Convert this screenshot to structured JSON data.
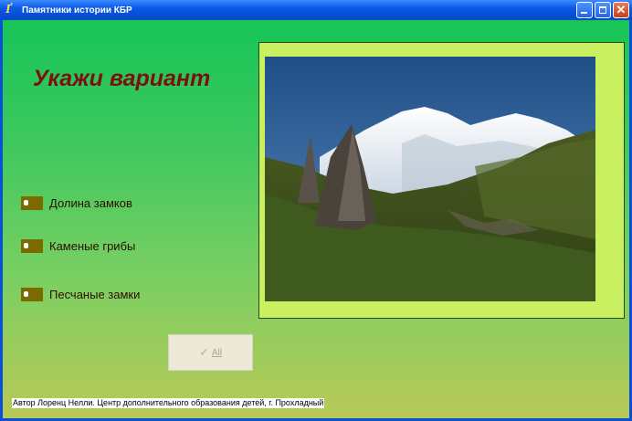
{
  "window": {
    "title": "Памятники истории КБР",
    "icon": "app-logo-icon"
  },
  "heading": "Укажи вариант",
  "options": [
    {
      "label": "Долина замков"
    },
    {
      "label": "Каменые грибы"
    },
    {
      "label": "Песчаные замки"
    }
  ],
  "photo": {
    "subject": "mountain-landscape-with-rock-spires"
  },
  "all_button": {
    "label": "All",
    "icon": "check-icon"
  },
  "footer": "Автор Лоренц Нелли. Центр дополнительного образования детей, г. Прохладный",
  "colors": {
    "titlebar": "#0a5ae6",
    "heading": "#7a1010",
    "radio": "#7a6a00",
    "frame": "#c9f060"
  }
}
